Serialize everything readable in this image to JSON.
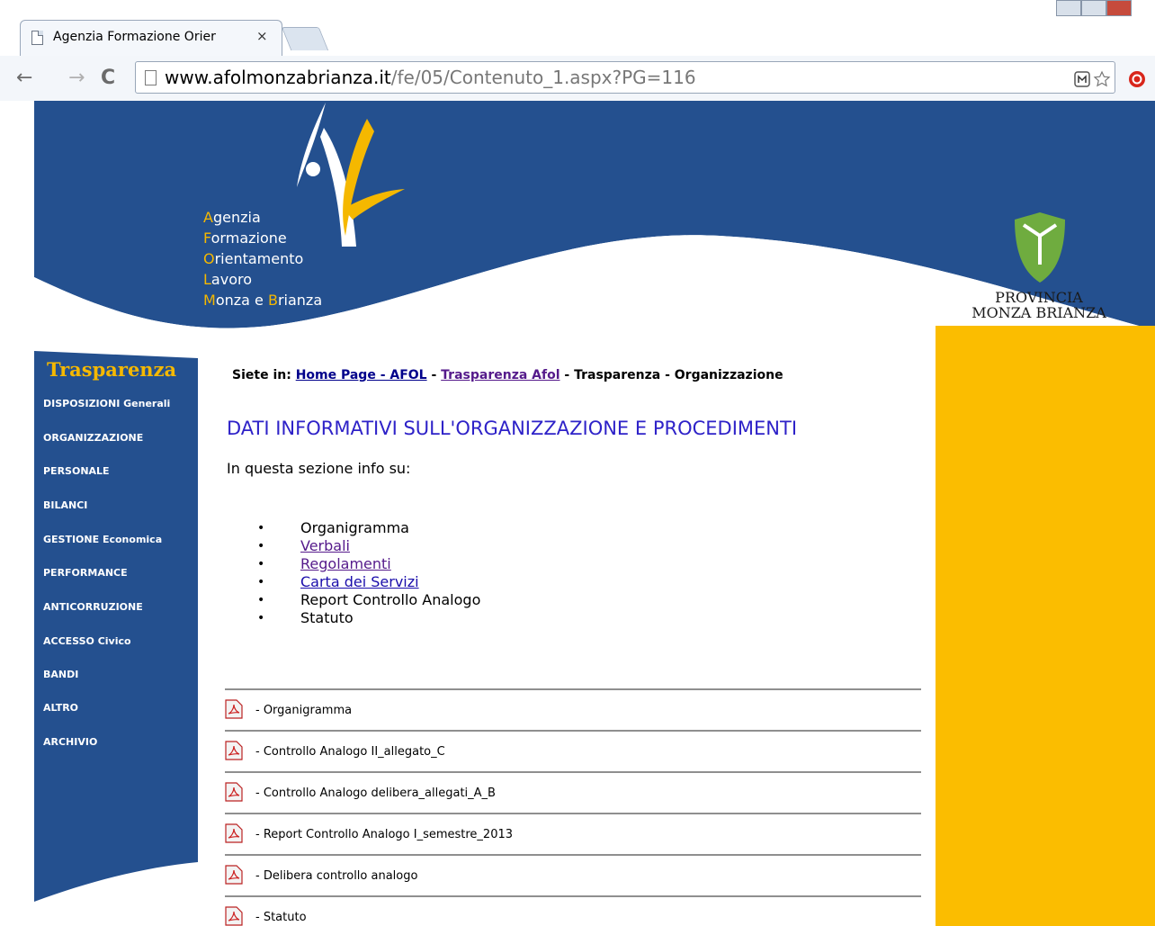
{
  "browser": {
    "tab_title": "Agenzia Formazione Orier",
    "tab_close": "×",
    "url_domain": "www.afolmonzabrianza.it",
    "url_path": "/fe/05/Contenuto_1.aspx?PG=116"
  },
  "header": {
    "logo_lines": [
      {
        "initial": "A",
        "rest": "genzia"
      },
      {
        "initial": "F",
        "rest": "ormazione"
      },
      {
        "initial": "O",
        "rest": "rientamento"
      },
      {
        "initial": "L",
        "rest": "avoro"
      },
      {
        "initial": "M",
        "rest": "onza e ",
        "initial2": "B",
        "rest2": "rianza"
      }
    ],
    "province_line1": "PROVINCIA",
    "province_line2": "MONZA BRIANZA"
  },
  "sidebar": {
    "title": "Trasparenza",
    "items": [
      {
        "label": "DISPOSIZIONI Generali"
      },
      {
        "label": "ORGANIZZAZIONE"
      },
      {
        "label": "PERSONALE"
      },
      {
        "label": "BILANCI"
      },
      {
        "label": "GESTIONE Economica"
      },
      {
        "label": "PERFORMANCE"
      },
      {
        "label": "ANTICORRUZIONE"
      },
      {
        "label": "ACCESSO Civico"
      },
      {
        "label": "BANDI"
      },
      {
        "label": "ALTRO"
      },
      {
        "label": "ARCHIVIO"
      }
    ]
  },
  "breadcrumb": {
    "prefix": "Siete in:",
    "link1": "Home Page - AFOL",
    "sep1": " - ",
    "link2": "Trasparenza Afol",
    "sep2": " - ",
    "current": "Trasparenza - Organizzazione"
  },
  "main": {
    "title": "DATI INFORMATIVI SULL'ORGANIZZAZIONE E PROCEDIMENTI",
    "intro": "In questa sezione info su:",
    "bullets": [
      {
        "label": "Organigramma"
      },
      {
        "label": "Verbali"
      },
      {
        "label": "Regolamenti"
      },
      {
        "label": "Carta dei Servizi"
      },
      {
        "label": "Report Controllo Analogo"
      },
      {
        "label": "Statuto"
      }
    ],
    "files": [
      {
        "label": "- Organigramma"
      },
      {
        "label": "- Controllo Analogo II_allegato_C"
      },
      {
        "label": "- Controllo Analogo delibera_allegati_A_B"
      },
      {
        "label": "- Report Controllo Analogo I_semestre_2013"
      },
      {
        "label": "- Delibera controllo analogo"
      },
      {
        "label": "- Statuto"
      }
    ]
  },
  "colors": {
    "header_blue": "#24508f",
    "accent_yellow": "#fbbd00",
    "province_green": "#6fac3f",
    "title_blue": "#2e22c8"
  }
}
